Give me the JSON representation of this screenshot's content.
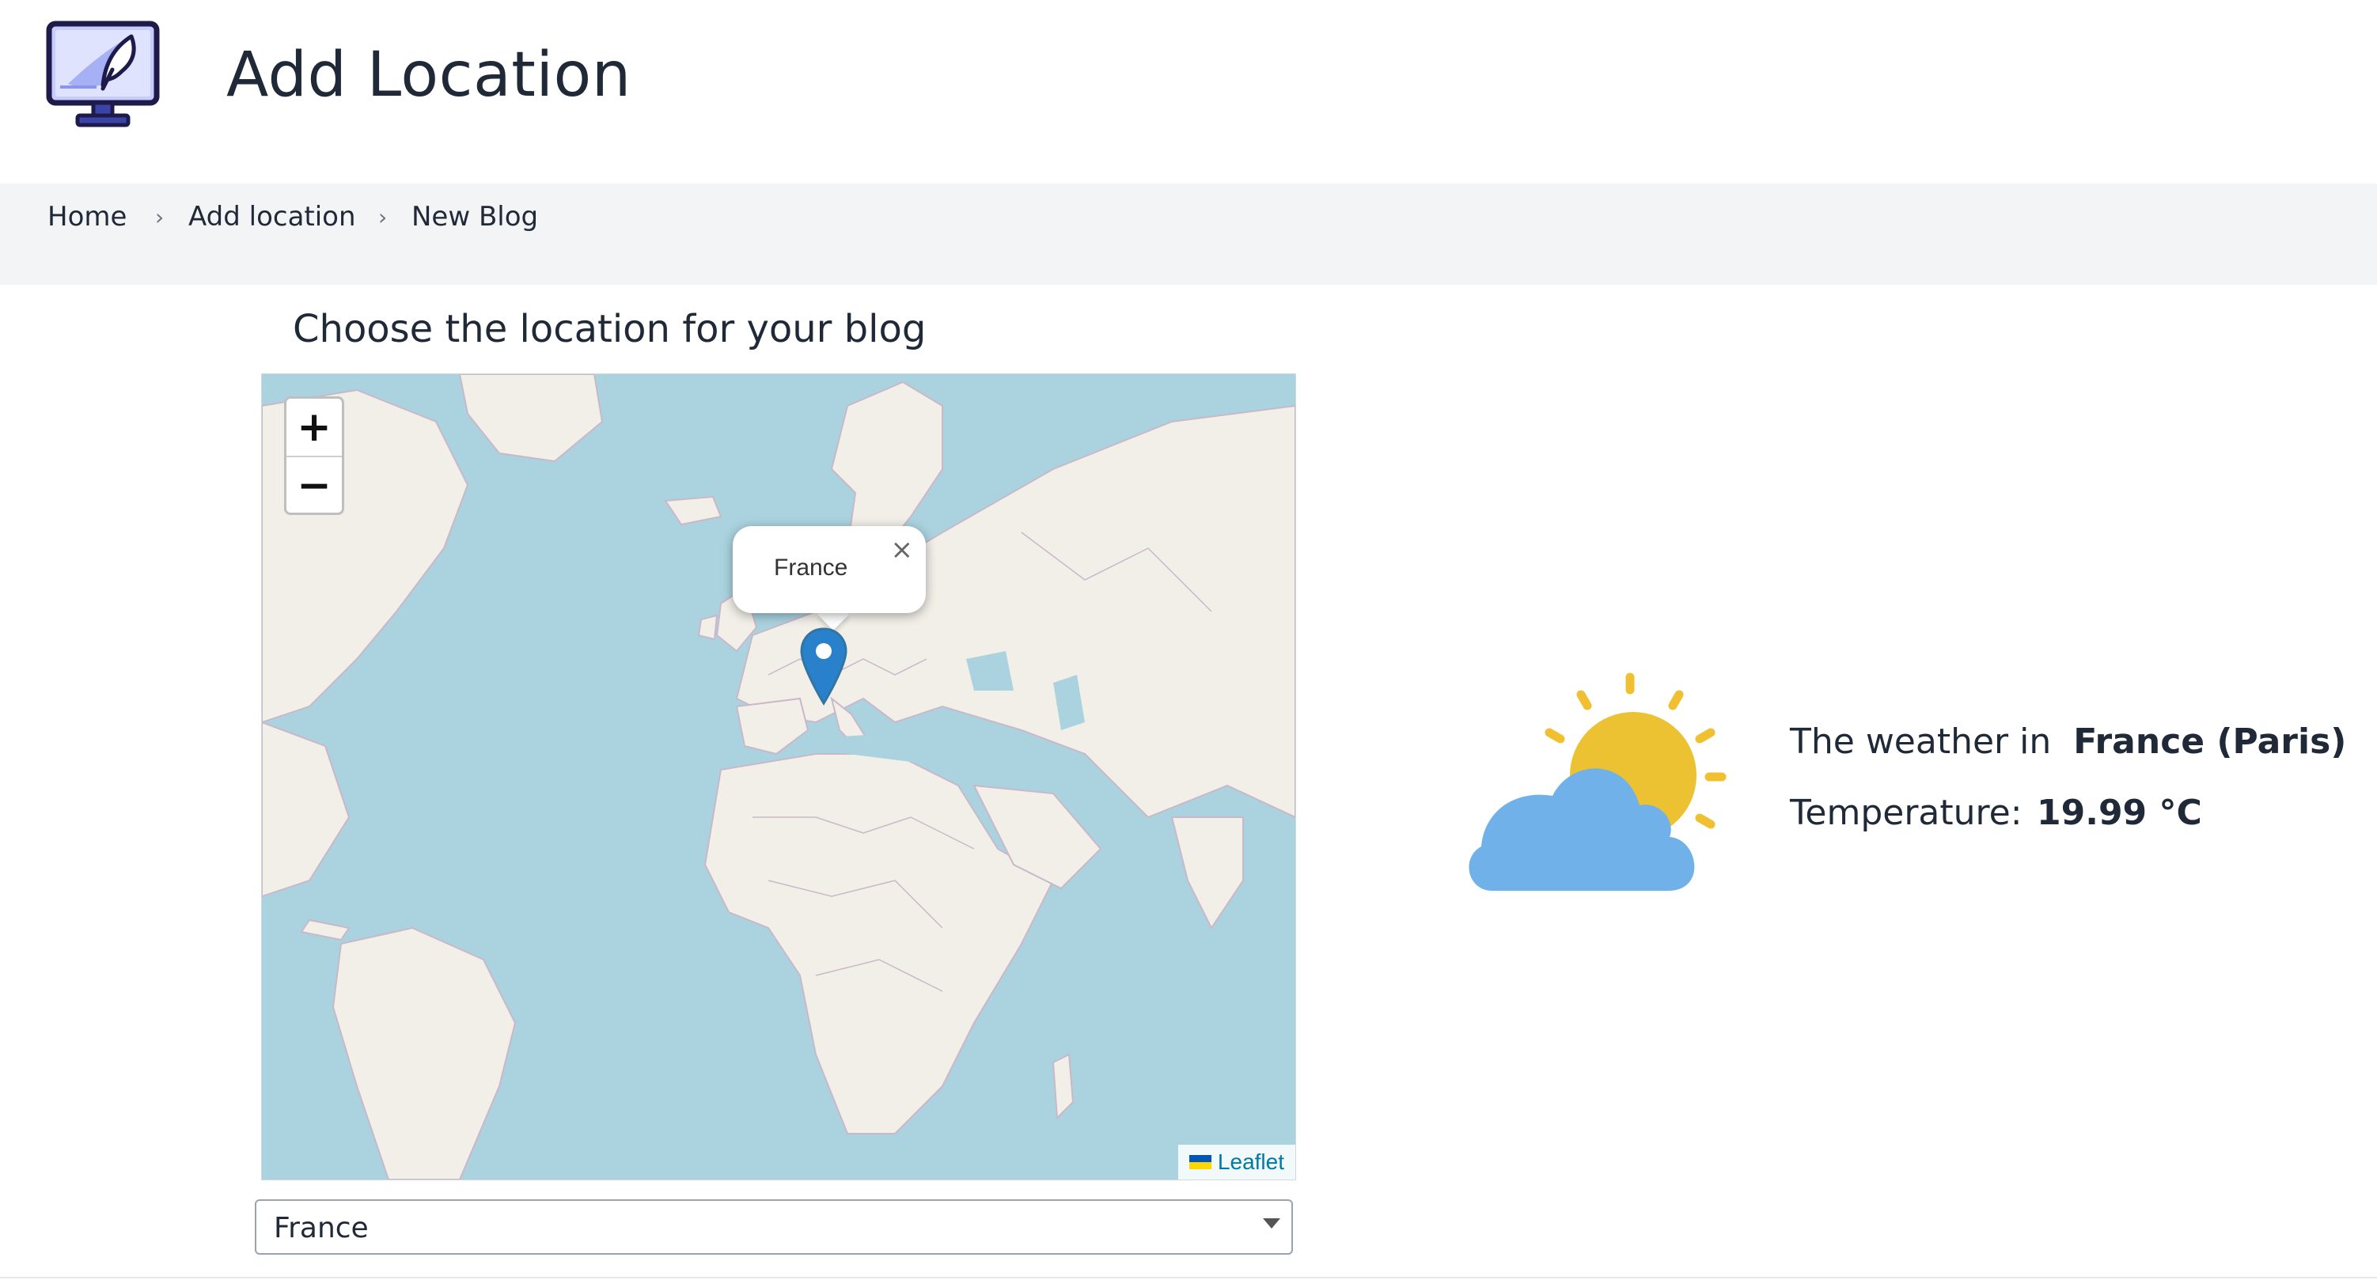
{
  "header": {
    "title": "Add Location",
    "logo_icon": "monitor-feather-icon"
  },
  "breadcrumb": [
    {
      "label": "Home"
    },
    {
      "label": "Add location"
    },
    {
      "label": "New Blog"
    }
  ],
  "breadcrumb_separator_icon": "chevron-right-icon",
  "main": {
    "subtitle": "Choose the location for your blog"
  },
  "map": {
    "zoom_in": "+",
    "zoom_out": "−",
    "popup_text": "France",
    "popup_close": "×",
    "attribution": "Leaflet",
    "ocean_color": "#aad3df",
    "land_color": "#f2efe9",
    "marker_color": "#2a81cb"
  },
  "country_select": {
    "value": "France"
  },
  "weather": {
    "prefix": "The weather in",
    "location": "France (Paris)",
    "temperature_label": "Temperature:",
    "temperature_value": "19.99 °C",
    "icon": "partly-cloudy-icon"
  }
}
